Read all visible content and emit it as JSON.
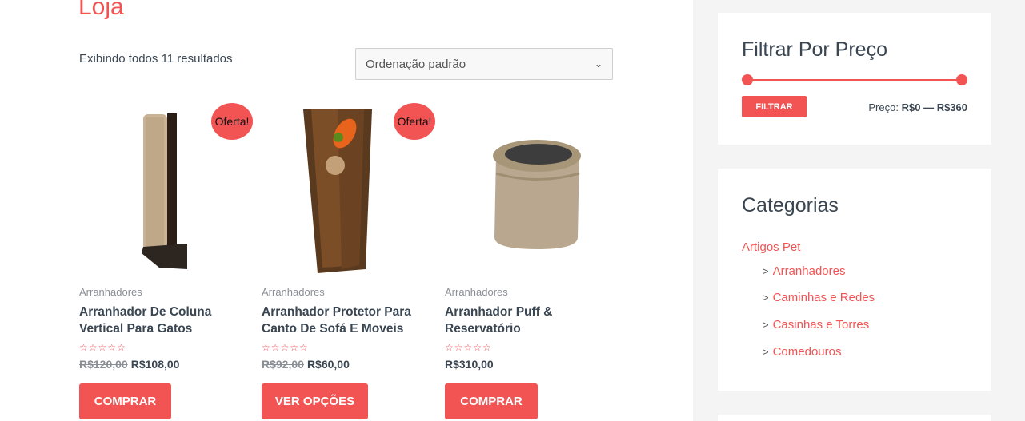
{
  "page": {
    "title": "Loja",
    "result_count": "Exibindo todos 11 resultados",
    "orderby_selected": "Ordenação padrão"
  },
  "products": [
    {
      "badge": "Oferta!",
      "category": "Arranhadores",
      "title_line1": "Arranhador De Coluna",
      "title_line2": "Vertical Para Gatos",
      "rating_stars": "☆☆☆☆☆",
      "old_price": "R$120,00",
      "price": "R$108,00",
      "button": "COMPRAR"
    },
    {
      "badge": "Oferta!",
      "category": "Arranhadores",
      "title_line1": "Arranhador Protetor Para",
      "title_line2": "Canto De Sofá E Moveis",
      "rating_stars": "☆☆☆☆☆",
      "old_price": "R$92,00",
      "price": "R$60,00",
      "button": "VER OPÇÕES"
    },
    {
      "category": "Arranhadores",
      "title_line1": "Arranhador Puff &",
      "title_line2": "Reservatório",
      "rating_stars": "☆☆☆☆☆",
      "price": "R$310,00",
      "button": "COMPRAR"
    }
  ],
  "price_filter": {
    "title": "Filtrar Por Preço",
    "button": "FILTRAR",
    "label_prefix": "Preço:",
    "min": "R$0",
    "separator": "—",
    "max": "R$360"
  },
  "categories": {
    "title": "Categorias",
    "parent": "Artigos Pet",
    "children": [
      "Arranhadores",
      "Caminhas e Redes",
      "Casinhas e Torres",
      "Comedouros"
    ]
  },
  "colors": {
    "accent": "#f25454",
    "text": "#3a4652",
    "muted": "#8a8f96",
    "sidebar_bg": "#f4f4f4"
  }
}
